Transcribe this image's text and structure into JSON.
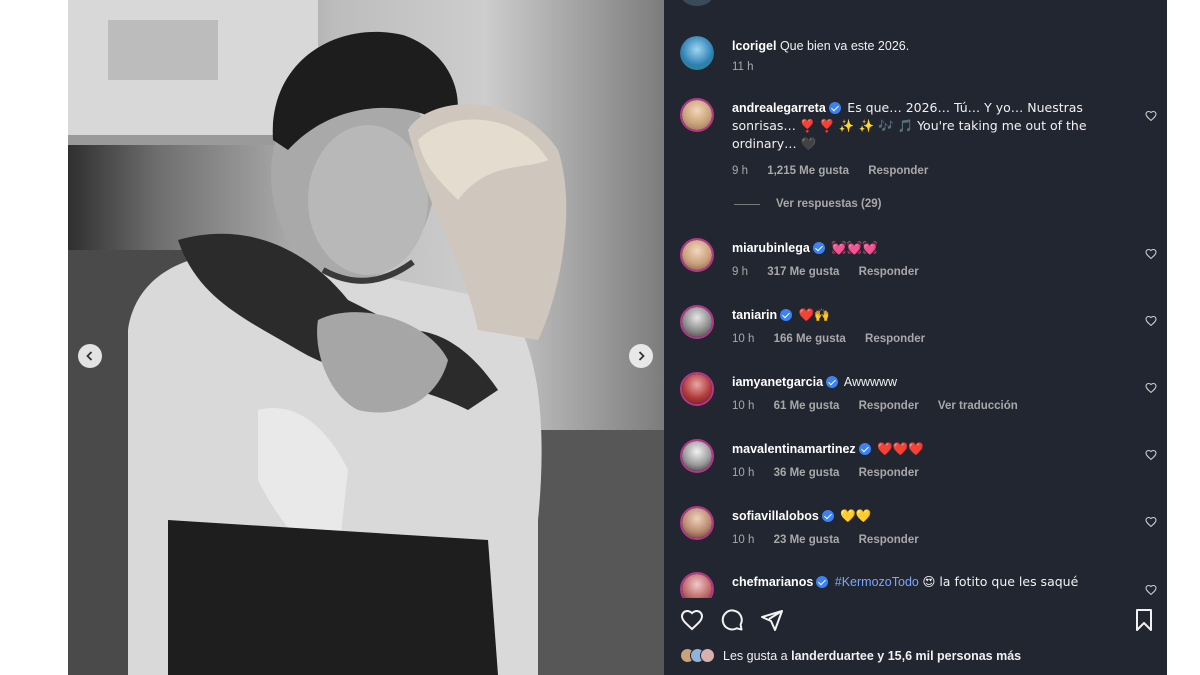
{
  "post": {
    "prev_label": "Anterior",
    "next_label": "Siguiente"
  },
  "comments": [
    {
      "username": "lcorigel",
      "text": "Que bien va este 2026.",
      "time": "11 h",
      "likes": "",
      "reply": "",
      "verified": false
    },
    {
      "username": "andrealegarreta",
      "text": "Es que… 2026… Tú… Y yo… Nuestras sonrisas… ❣️ ❣️ ✨ ✨ 🎶 🎵 You're taking me out of the ordinary… 🖤",
      "time": "9 h",
      "likes": "1,215 Me gusta",
      "reply": "Responder",
      "verified": true
    },
    {
      "username": "miarubinlega",
      "text": "💓💓💓",
      "time": "9 h",
      "likes": "317 Me gusta",
      "reply": "Responder",
      "verified": true
    },
    {
      "username": "taniarin",
      "text": "❤️🙌",
      "time": "10 h",
      "likes": "166 Me gusta",
      "reply": "Responder",
      "verified": true
    },
    {
      "username": "iamyanetgarcia",
      "text": "Awwwww",
      "time": "10 h",
      "likes": "61 Me gusta",
      "reply": "Responder",
      "translate": "Ver traducción",
      "verified": true
    },
    {
      "username": "mavalentinamartinez",
      "text": "❤️❤️❤️",
      "time": "10 h",
      "likes": "36 Me gusta",
      "reply": "Responder",
      "verified": true
    },
    {
      "username": "sofiavillalobos",
      "text": "💛💛",
      "time": "10 h",
      "likes": "23 Me gusta",
      "reply": "Responder",
      "verified": true
    },
    {
      "username": "chefmarianos",
      "hashtag": "#KermozoTodo",
      "text": "😍 la fotito que les saqué",
      "verified": true
    }
  ],
  "replies_label": "Ver respuestas (29)",
  "likes_summary": {
    "prefix": "Les gusta a",
    "user": "landerduartee",
    "suffix": "y 15,6 mil personas más"
  },
  "icons": [
    "chevron-left-icon",
    "chevron-right-icon",
    "heart-icon",
    "comment-icon",
    "share-icon",
    "bookmark-icon",
    "verified-icon"
  ],
  "colors": {
    "panel_bg": "#222630",
    "verified": "#3b82f6",
    "hashtag": "#7aa6ff",
    "story_ring": "#b7358c"
  }
}
